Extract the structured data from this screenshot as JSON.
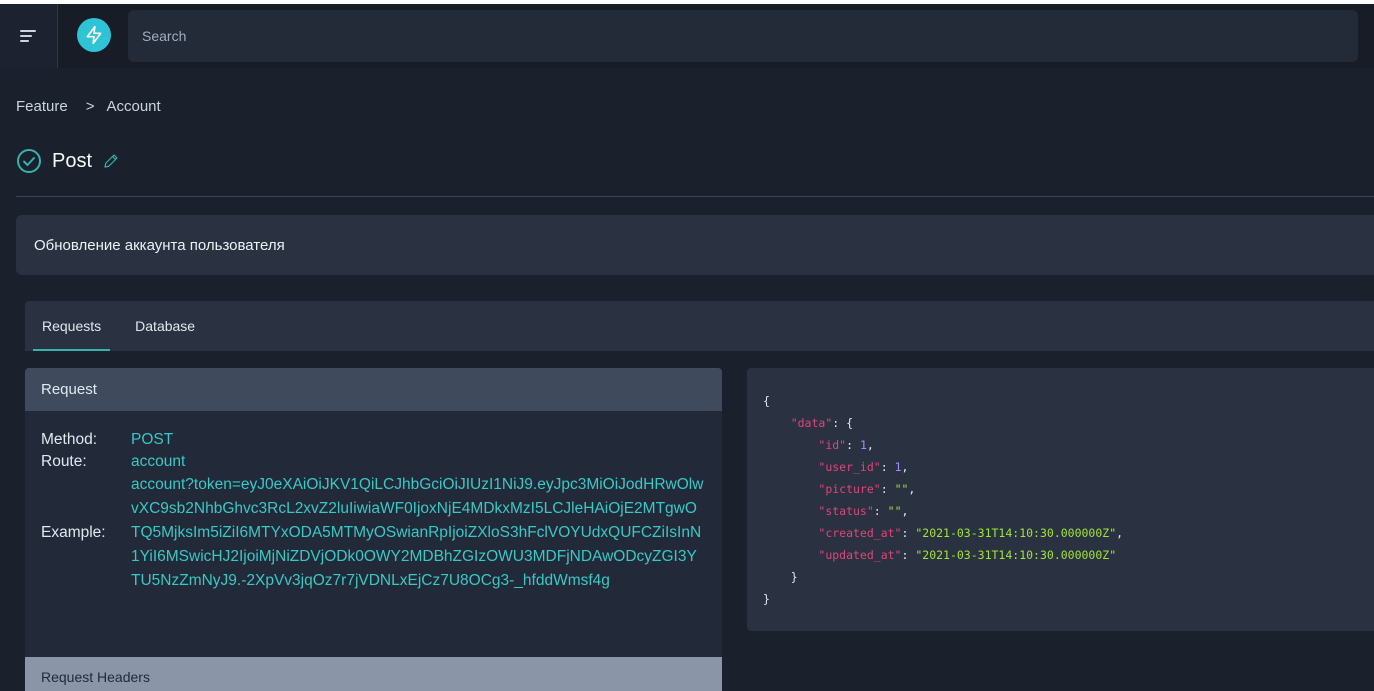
{
  "topbar": {
    "search_placeholder": "Search"
  },
  "breadcrumb": {
    "root": "Feature",
    "separator": ">",
    "current": "Account"
  },
  "page": {
    "title": "Post",
    "description": "Обновление аккаунта пользователя"
  },
  "tabs": [
    {
      "label": "Requests",
      "active": true
    },
    {
      "label": "Database",
      "active": false
    }
  ],
  "request": {
    "header": "Request",
    "method_label": "Method:",
    "method_value": "POST",
    "route_label": "Route:",
    "route_value": "account",
    "example_label": "Example:",
    "example_value": "account?token=eyJ0eXAiOiJKV1QiLCJhbGciOiJIUzI1NiJ9.eyJpc3MiOiJodHRwOlwvXC9sb2NhbGhvc3RcL2xvZ2luIiwiaWF0IjoxNjE4MDkxMzI5LCJleHAiOjE2MTgwOTQ5MjksIm5iZiI6MTYxODA5MTMyOSwianRpIjoiZXloS3hFclVOYUdxQUFCZiIsInN1YiI6MSwicHJ2IjoiMjNiZDVjODk0OWY2MDBhZGIzOWU3MDFjNDAwODcyZGI3YTU5NzZmNyJ9.-2XpVv3jqOz7r7jVDNLxEjCz7U8OCg3-_hfddWmsf4g",
    "headers_label": "Request Headers"
  },
  "response_json": {
    "open_brace": "{",
    "data_key": "\"data\"",
    "fields": [
      {
        "key": "\"id\"",
        "value": "1",
        "kind": "num",
        "comma": ","
      },
      {
        "key": "\"user_id\"",
        "value": "1",
        "kind": "num",
        "comma": ","
      },
      {
        "key": "\"picture\"",
        "value": "\"\"",
        "kind": "str",
        "comma": ","
      },
      {
        "key": "\"status\"",
        "value": "\"\"",
        "kind": "str",
        "comma": ","
      },
      {
        "key": "\"created_at\"",
        "value": "\"2021-03-31T14:10:30.000000Z\"",
        "kind": "str",
        "comma": ","
      },
      {
        "key": "\"updated_at\"",
        "value": "\"2021-03-31T14:10:30.000000Z\"",
        "kind": "str",
        "comma": ""
      }
    ],
    "inner_close": "}",
    "close_brace": "}"
  },
  "colors": {
    "accent": "#38b2ac",
    "link": "#38c9c5",
    "logo": "#2ec4d6",
    "json_key": "#e0457b",
    "json_num": "#a78bfa",
    "json_str": "#a3e635"
  },
  "icons": {
    "menu": "menu-icon",
    "logo": "lightning-icon",
    "status": "check-circle-icon",
    "edit": "pencil-icon"
  }
}
